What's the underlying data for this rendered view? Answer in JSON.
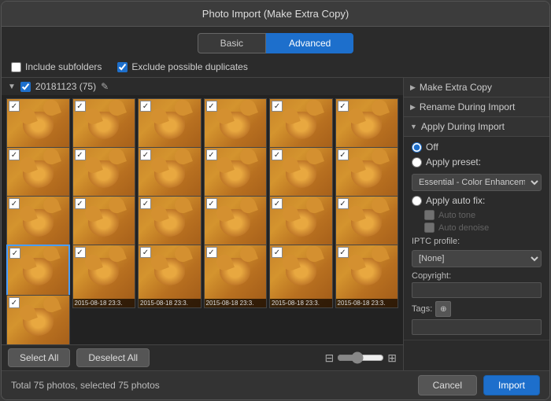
{
  "dialog": {
    "title": "Photo Import (Make Extra Copy)",
    "tabs": [
      {
        "id": "basic",
        "label": "Basic",
        "active": false
      },
      {
        "id": "advanced",
        "label": "Advanced",
        "active": true
      }
    ]
  },
  "options_bar": {
    "include_subfolders_label": "Include subfolders",
    "exclude_duplicates_label": "Exclude possible duplicates"
  },
  "folder": {
    "name": "20181123 (75)",
    "checked": true
  },
  "photos": {
    "date_label": "2015-08-18 23:3.",
    "count": 25
  },
  "bottom_bar": {
    "select_all": "Select All",
    "deselect_all": "Deselect All"
  },
  "right_panel": {
    "sections": [
      {
        "id": "make-extra-copy",
        "label": "Make Extra Copy",
        "expanded": false
      },
      {
        "id": "rename-during-import",
        "label": "Rename During Import",
        "expanded": false
      },
      {
        "id": "apply-during-import",
        "label": "Apply During Import",
        "expanded": true
      }
    ],
    "apply_during_import": {
      "off_label": "Off",
      "apply_preset_label": "Apply preset:",
      "preset_value": "Essential - Color Enhancement",
      "apply_auto_fix_label": "Apply auto fix:",
      "auto_tone_label": "Auto tone",
      "auto_denoise_label": "Auto denoise",
      "iptc_profile_label": "IPTC profile:",
      "iptc_value": "[None]",
      "copyright_label": "Copyright:",
      "tags_label": "Tags:"
    }
  },
  "status_bar": {
    "status_text": "Total 75 photos, selected 75 photos",
    "cancel_label": "Cancel",
    "import_label": "Import"
  }
}
